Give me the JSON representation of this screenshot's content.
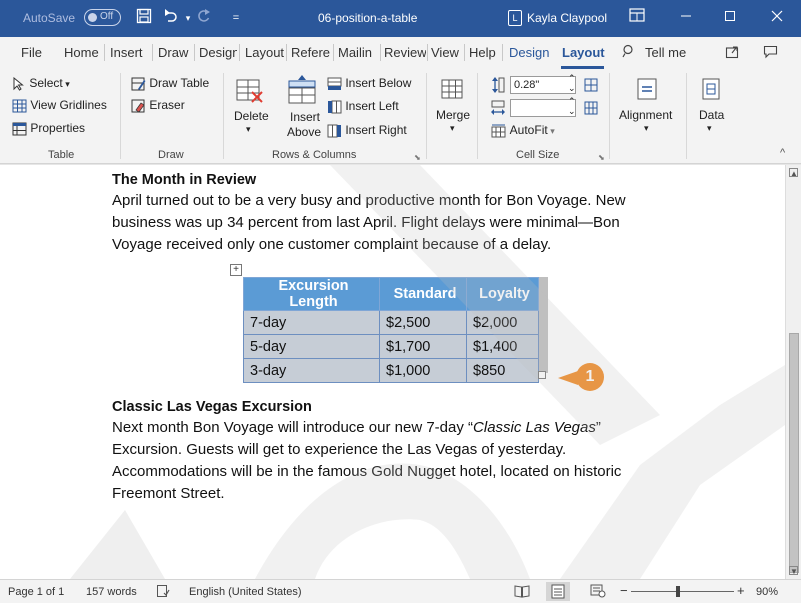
{
  "titlebar": {
    "autosave_label": "AutoSave",
    "autosave_state": "Off",
    "doc_title": "06-position-a-table",
    "user_name": "Kayla Claypool"
  },
  "tabs": [
    "File",
    "Home",
    "Insert",
    "Draw",
    "Design",
    "Layout",
    "Refere",
    "Mailin",
    "Review",
    "View",
    "Help",
    "Design",
    "Layout"
  ],
  "tell_me": "Tell me",
  "ribbon": {
    "table_group": {
      "select": "Select",
      "view_gridlines": "View Gridlines",
      "properties": "Properties",
      "label": "Table"
    },
    "draw_group": {
      "draw_table": "Draw Table",
      "eraser": "Eraser",
      "label": "Draw"
    },
    "rows_group": {
      "delete": "Delete",
      "insert_above_1": "Insert",
      "insert_above_2": "Above",
      "insert_below": "Insert Below",
      "insert_left": "Insert Left",
      "insert_right": "Insert Right",
      "label": "Rows & Columns"
    },
    "merge_group": {
      "merge": "Merge"
    },
    "cell_size_group": {
      "height_value": "0.28\"",
      "width_value": "",
      "autofit": "AutoFit",
      "label": "Cell Size"
    },
    "alignment": "Alignment",
    "data": "Data"
  },
  "document": {
    "heading1": "The Month in Review",
    "para1": "April turned out to be a very busy and productive month for Bon Voyage. New business was up 34 percent from last April. Flight delays were minimal—Bon Voyage received only one customer complaint because of a delay.",
    "table": {
      "headers": [
        "Excursion Length",
        "Standard",
        "Loyalty"
      ],
      "rows": [
        [
          "7-day",
          "$2,500",
          "$2,000"
        ],
        [
          "5-day",
          "$1,700",
          "$1,400"
        ],
        [
          "3-day",
          "$1,000",
          "$850"
        ]
      ]
    },
    "callout_number": "1",
    "heading2": "Classic Las Vegas Excursion",
    "para2_pre": "Next month Bon Voyage will introduce our new 7-day “",
    "para2_italic": "Classic Las Vegas",
    "para2_post": "” Excursion. Guests will get to experience the Las Vegas of yesterday. Accommodations will be in the famous Gold Nugget hotel, located on historic Freemont Street."
  },
  "statusbar": {
    "page": "Page 1 of 1",
    "words": "157 words",
    "language": "English (United States)",
    "zoom": "90%"
  }
}
